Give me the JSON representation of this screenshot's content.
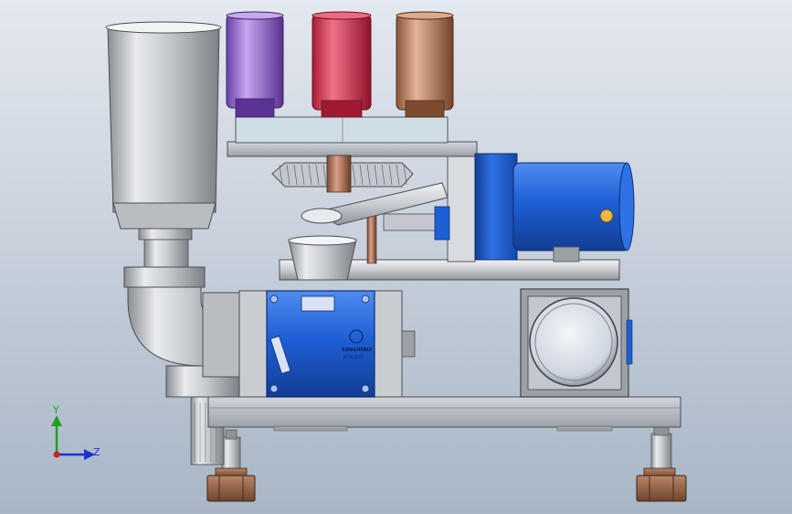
{
  "viewport": {
    "background_top": "#e4e8ef",
    "background_bottom": "#a8b6c6"
  },
  "axis_triad": {
    "y_label": "Y",
    "z_label": "Z",
    "y_color": "#1ea01e",
    "z_color": "#1e2fd6",
    "x_color": "#d41e1e"
  },
  "model": {
    "cup_colors": [
      "#8f5bd1",
      "#d6344e",
      "#b87d5a"
    ],
    "motor_color": "#1e5fd6",
    "gearbox_color": "#1e5fd6",
    "feet_color": "#9a6a4e",
    "motor_label": {
      "brand": "SONGHEBIZ",
      "model": "JS-30-2015"
    }
  }
}
